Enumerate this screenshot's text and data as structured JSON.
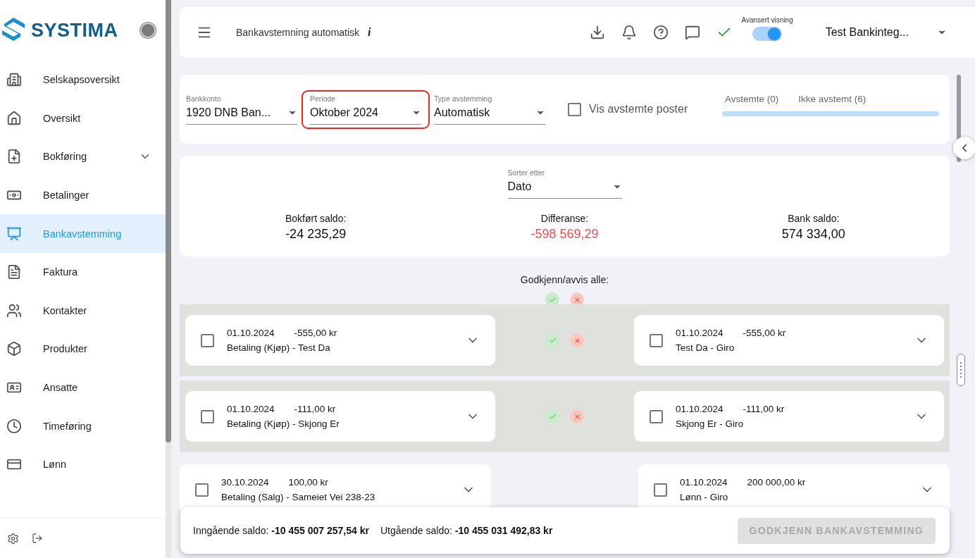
{
  "sidebar": {
    "logo": "SYSTIMA",
    "items": [
      {
        "label": "Selskapsoversikt",
        "selected": false
      },
      {
        "label": "Oversikt",
        "selected": false
      },
      {
        "label": "Bokføring",
        "selected": false,
        "submenu": true
      },
      {
        "label": "Betalinger",
        "selected": false
      },
      {
        "label": "Bankavstemming",
        "selected": true
      },
      {
        "label": "Faktura",
        "selected": false
      },
      {
        "label": "Kontakter",
        "selected": false
      },
      {
        "label": "Produkter",
        "selected": false
      },
      {
        "label": "Ansatte",
        "selected": false
      },
      {
        "label": "Timeføring",
        "selected": false
      },
      {
        "label": "Lønn",
        "selected": false
      }
    ]
  },
  "topbar": {
    "title": "Bankavstemning automatisk",
    "info": "i",
    "toggle": {
      "label": "Avansert visning",
      "on": true
    },
    "company": "Test Bankinteg..."
  },
  "filters": {
    "fields": [
      {
        "label": "Bankkonto",
        "value": "1920 DNB Ban...",
        "highlighted": false
      },
      {
        "label": "Periode",
        "value": "Oktober 2024",
        "highlighted": true
      },
      {
        "label": "Type avstemming",
        "value": "Automatisk",
        "highlighted": false
      }
    ],
    "checkbox": {
      "label": "Vis avstemte poster",
      "checked": false
    },
    "tabs": [
      {
        "label": "Avstemte (0)",
        "selected": false
      },
      {
        "label": "Ikke avstemt (6)",
        "selected": false
      }
    ]
  },
  "summary": {
    "sort": {
      "label": "Sorter etter",
      "value": "Dato"
    },
    "balances": [
      {
        "label": "Bokført saldo:",
        "value": "-24 235,29",
        "color": "#111111"
      },
      {
        "label": "Differanse:",
        "value": "-598 569,29",
        "color": "#f04e4e"
      },
      {
        "label": "Bank saldo:",
        "value": "574 334,00",
        "color": "#111111"
      }
    ]
  },
  "approve_all": {
    "label": "Godkjenn/avvis alle:"
  },
  "pairs": [
    {
      "matched": true,
      "left": {
        "date": "01.10.2024",
        "amount": "-555,00 kr",
        "text": "Betaling (Kjøp) - Test Da",
        "checked": false
      },
      "right": {
        "date": "01.10.2024",
        "amount": "-555,00 kr",
        "text": "Test Da - Giro",
        "checked": false
      }
    },
    {
      "matched": true,
      "left": {
        "date": "01.10.2024",
        "amount": "-111,00 kr",
        "text": "Betaling (Kjøp) - Skjong Er",
        "checked": false
      },
      "right": {
        "date": "01.10.2024",
        "amount": "-111,00 kr",
        "text": "Skjong Er - Giro",
        "checked": false
      }
    },
    {
      "matched": false,
      "left": {
        "date": "30.10.2024",
        "amount": "100,00 kr",
        "text": "Betaling (Salg) - Sameiet Vei 238-23",
        "checked": false
      },
      "right": {
        "date": "01.10.2024",
        "amount": "200 000,00 kr",
        "text": "Lønn - Giro",
        "checked": false
      }
    }
  ],
  "footer": {
    "incoming": "Inngående saldo: **-10 455 007 257,54 kr**",
    "outgoing": "Utgående saldo: **-10 455 031 492,83 kr**",
    "button": {
      "label": "GODKJENN BANKAVSTEMMING",
      "disabled": true
    }
  }
}
